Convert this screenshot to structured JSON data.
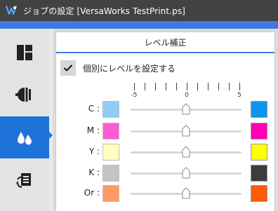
{
  "window": {
    "title": "ジョブの設定 [VersaWorks TestPrint.ps]",
    "logo_icon": "versaworks-logo-icon"
  },
  "colors": {
    "titlebar": "#424242",
    "accent": "#3f79e0",
    "sidebar_active": "#1e73d8"
  },
  "sidebar": {
    "items": [
      {
        "icon": "layout-icon",
        "active": false
      },
      {
        "icon": "color-management-icon",
        "active": false
      },
      {
        "icon": "ink-drops-icon",
        "active": true
      },
      {
        "icon": "print-settings-icon",
        "active": false
      }
    ]
  },
  "panel": {
    "title": "レベル補正",
    "individual_label": "個別にレベルを設定する",
    "individual_checked": true,
    "scale": {
      "min": -5,
      "max": 5,
      "labels": [
        "-5",
        "0",
        "5"
      ]
    },
    "channels": [
      {
        "label": "C :",
        "value": 0,
        "light": "#8ecdf8",
        "dark": "#0a96f0"
      },
      {
        "label": "M :",
        "value": 0,
        "light": "#ff5ad2",
        "dark": "#ff00b4"
      },
      {
        "label": "Y :",
        "value": 0,
        "light": "#ffffc0",
        "dark": "#ffff00"
      },
      {
        "label": "K :",
        "value": 0,
        "light": "#c4c4c4",
        "dark": "#3c3c3c"
      },
      {
        "label": "Or :",
        "value": 0,
        "light": "#ff9a64",
        "dark": "#ff5a0a"
      }
    ]
  }
}
